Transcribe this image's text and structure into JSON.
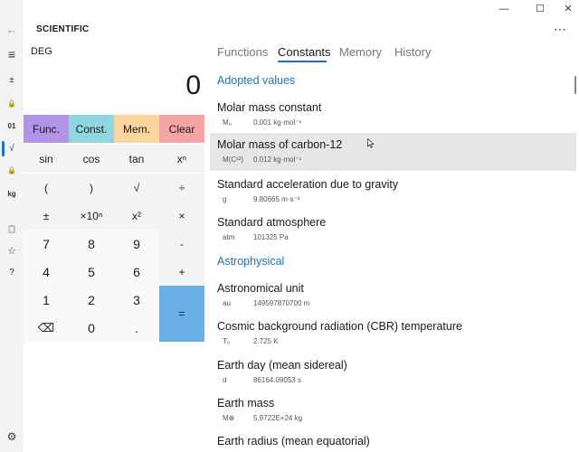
{
  "window": {
    "back_icon": "←",
    "minimize_icon": "—",
    "maximize_icon": "☐",
    "close_icon": "✕",
    "more_icon": "⋯"
  },
  "rail": {
    "menu_icon": "≡",
    "plus_minus": "±",
    "lock_icon": "🔒",
    "binary": "01",
    "sqrt": "√",
    "lock2_icon": "🔒",
    "kg": "kg",
    "clipboard_icon": "📋",
    "favorite_icon": "☆",
    "help": "?",
    "settings_icon": "⚙"
  },
  "mode_title": "SCIENTIFIC",
  "angle_mode": "DEG",
  "display_value": "0",
  "keypad": {
    "top": [
      "Func.",
      "Const.",
      "Mem.",
      "Clear"
    ],
    "row1": [
      "sin",
      "cos",
      "tan",
      "xⁿ"
    ],
    "row2": [
      "(",
      ")",
      "√",
      "÷"
    ],
    "row3": [
      "±",
      "×10ⁿ",
      "x²",
      "×"
    ],
    "row4": [
      "7",
      "8",
      "9",
      "-"
    ],
    "row5": [
      "4",
      "5",
      "6",
      "+"
    ],
    "row6": [
      "1",
      "2",
      "3",
      "="
    ],
    "row7": [
      "⌫",
      "0",
      "."
    ]
  },
  "tabs": [
    "Functions",
    "Constants",
    "Memory",
    "History"
  ],
  "active_tab": "Constants",
  "sections": [
    {
      "title": "Adopted values",
      "entries": [
        {
          "name": "Molar mass constant",
          "symbol": "Mᵤ",
          "value": "0.001 kg·mol⁻¹"
        },
        {
          "name": "Molar mass of carbon-12",
          "symbol": "M(C¹²)",
          "value": "0.012 kg·mol⁻¹"
        },
        {
          "name": "Standard acceleration due to gravity",
          "symbol": "g",
          "value": "9.80665 m·s⁻²"
        },
        {
          "name": "Standard atmosphere",
          "symbol": "atm",
          "value": "101325 Pa"
        }
      ]
    },
    {
      "title": "Astrophysical",
      "entries": [
        {
          "name": "Astronomical unit",
          "symbol": "au",
          "value": "149597870700 m"
        },
        {
          "name": "Cosmic background radiation (CBR) temperature",
          "symbol": "T₀",
          "value": "2.725 K"
        },
        {
          "name": "Earth day (mean sidereal)",
          "symbol": "d",
          "value": "86164.09053 s"
        },
        {
          "name": "Earth mass",
          "symbol": "M⊕",
          "value": "5.9722E+24 kg"
        },
        {
          "name": "Earth radius (mean equatorial)",
          "symbol": "",
          "value": ""
        }
      ]
    }
  ],
  "colors": {
    "accent": "#1a73d1",
    "func": "#b294e6",
    "const": "#8fd6de",
    "mem": "#fcd49e",
    "clear": "#f6a3a3",
    "equals": "#6ab0e8",
    "highlight_row": "#e6e6e6"
  }
}
